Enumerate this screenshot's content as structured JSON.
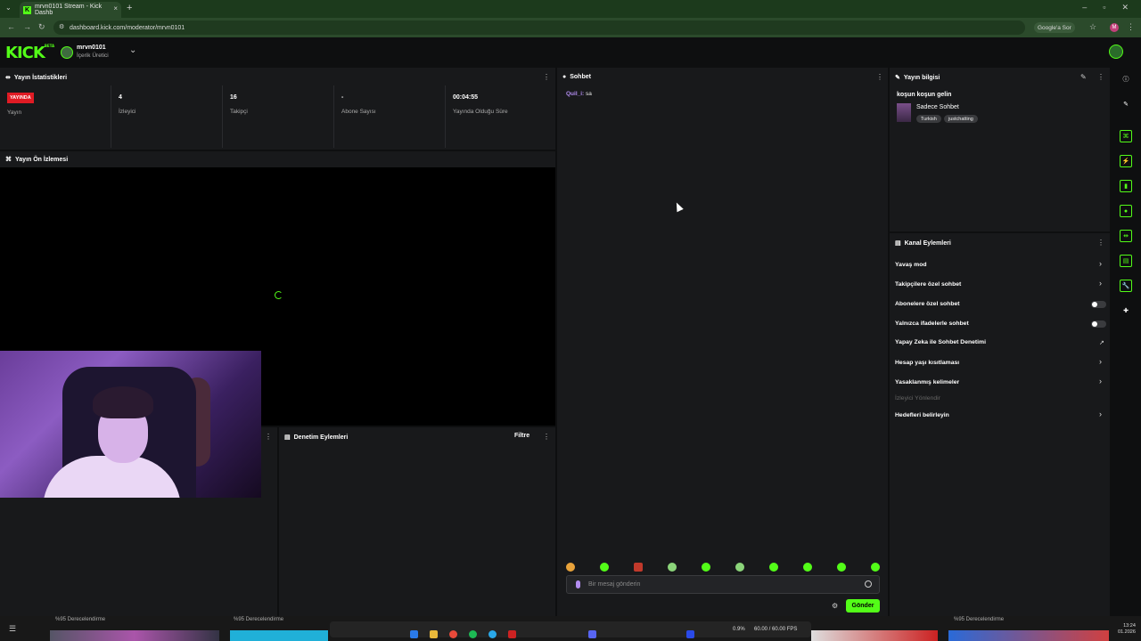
{
  "browser": {
    "tab_title": "mrvn0101 Stream - Kick Dashb",
    "tab_favicon": "K",
    "url": "dashboard.kick.com/moderator/mrvn0101",
    "google_label": "Google'a Sor",
    "profile_initial": "M"
  },
  "header": {
    "logo": "KICK",
    "logo_badge": "BETA",
    "username": "mrvn0101",
    "role": "İçerik Üretici"
  },
  "stats": {
    "title": "Yayın İstatistikleri",
    "live_badge": "YAYINDA",
    "items": [
      {
        "value": "",
        "label": "Yayın"
      },
      {
        "value": "4",
        "label": "İzleyici"
      },
      {
        "value": "16",
        "label": "Takipçi"
      },
      {
        "value": "-",
        "label": "Abone Sayısı"
      },
      {
        "value": "00:04:55",
        "label": "Yayında Olduğu Süre"
      }
    ]
  },
  "preview": {
    "title": "Yayın Ön İzlemesi"
  },
  "moderation": {
    "title": "Denetim Eylemleri",
    "filter_label": "Filtre"
  },
  "chat": {
    "title": "Sohbet",
    "messages": [
      {
        "user": "Quil_i:",
        "text": "sa"
      }
    ],
    "input_placeholder": "Bir mesaj gönderin",
    "send_label": "Gönder"
  },
  "stream_info": {
    "title": "Yayın bilgisi",
    "stream_title": "koşun koşun gelin",
    "category": "Sadece Sohbet",
    "tags": [
      "Turkish",
      "justchatting"
    ]
  },
  "channel_actions": {
    "title": "Kanal Eylemleri",
    "items": [
      {
        "label": "Yavaş mod",
        "control": "chevron"
      },
      {
        "label": "Takipçilere özel sohbet",
        "control": "chevron"
      },
      {
        "label": "Abonelere özel sohbet",
        "control": "toggle"
      },
      {
        "label": "Yalnızca ifadelerle sohbet",
        "control": "toggle"
      },
      {
        "label": "Yapay Zeka ile Sohbet Denetimi",
        "control": "external"
      },
      {
        "label": "Hesap yaşı kısıtlaması",
        "control": "chevron"
      },
      {
        "label": "Yasaklanmış kelimeler",
        "control": "chevron"
      },
      {
        "label": "İzleyici Yönlendir",
        "control": "none"
      },
      {
        "label": "Hedefleri belirleyin",
        "control": "chevron"
      }
    ]
  },
  "taskbar": {
    "thumb_labels": [
      "%95 Derecelendirme",
      "%95 Derecelendirme",
      "%95 Derecelendirme"
    ],
    "fps": "60.00 / 60.00 FPS",
    "cpu": "0.9%",
    "clock_time": "13:24",
    "clock_date": "01.2026"
  },
  "colors": {
    "accent": "#53fc18",
    "live": "#e01b24",
    "panel": "#18191b"
  }
}
